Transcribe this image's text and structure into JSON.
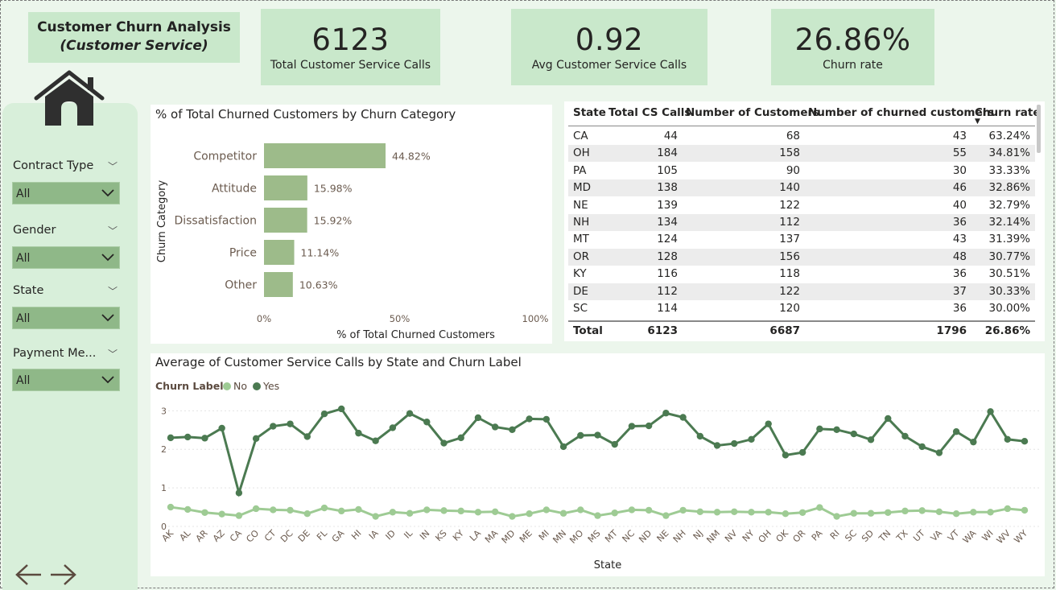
{
  "header": {
    "title_line1": "Customer Churn Analysis",
    "title_line2": "(Customer Service)"
  },
  "kpis": [
    {
      "value": "6123",
      "label": "Total Customer Service Calls"
    },
    {
      "value": "0.92",
      "label": "Avg Customer Service Calls"
    },
    {
      "value": "26.86%",
      "label": "Churn rate"
    }
  ],
  "icons": {
    "home": "home-icon",
    "back": "arrow-left-icon",
    "forward": "arrow-right-icon"
  },
  "slicers": [
    {
      "label": "Contract Type",
      "value": "All"
    },
    {
      "label": "Gender",
      "value": "All"
    },
    {
      "label": "State",
      "value": "All"
    },
    {
      "label": "Payment Me...",
      "value": "All"
    }
  ],
  "colors": {
    "accent": "#9dbb8a",
    "no": "#9ecb94",
    "yes": "#4b7a51"
  },
  "bar_chart": {
    "title": "% of Total Churned Customers by Churn Category",
    "chart_data": {
      "type": "bar",
      "categories": [
        "Competitor",
        "Attitude",
        "Dissatisfaction",
        "Price",
        "Other"
      ],
      "values": [
        44.82,
        15.98,
        15.92,
        11.14,
        10.63
      ],
      "value_labels": [
        "44.82%",
        "15.98%",
        "15.92%",
        "11.14%",
        "10.63%"
      ],
      "ylabel": "Churn Category",
      "xlabel": "% of Total Churned Customers",
      "xlim": [
        0,
        100
      ],
      "ticks": [
        "0%",
        "50%",
        "100%"
      ],
      "orientation": "horizontal"
    }
  },
  "table": {
    "headers": [
      "State",
      "Total CS Calls",
      "Number of Customers",
      "Number of churned customers",
      "Churn rate"
    ],
    "rows": [
      [
        "CA",
        "44",
        "68",
        "43",
        "63.24%"
      ],
      [
        "OH",
        "184",
        "158",
        "55",
        "34.81%"
      ],
      [
        "PA",
        "105",
        "90",
        "30",
        "33.33%"
      ],
      [
        "MD",
        "138",
        "140",
        "46",
        "32.86%"
      ],
      [
        "NE",
        "139",
        "122",
        "40",
        "32.79%"
      ],
      [
        "NH",
        "134",
        "112",
        "36",
        "32.14%"
      ],
      [
        "MT",
        "124",
        "137",
        "43",
        "31.39%"
      ],
      [
        "OR",
        "128",
        "156",
        "48",
        "30.77%"
      ],
      [
        "KY",
        "116",
        "118",
        "36",
        "30.51%"
      ],
      [
        "DE",
        "112",
        "122",
        "37",
        "30.33%"
      ],
      [
        "SC",
        "114",
        "120",
        "36",
        "30.00%"
      ]
    ],
    "total": [
      "Total",
      "6123",
      "6687",
      "1796",
      "26.86%"
    ]
  },
  "line_chart": {
    "title": "Average of Customer Service Calls by State and Churn Label",
    "legend_title": "Churn Label",
    "chart_data": {
      "type": "line",
      "categories": [
        "AK",
        "AL",
        "AR",
        "AZ",
        "CA",
        "CO",
        "CT",
        "DC",
        "DE",
        "FL",
        "GA",
        "HI",
        "IA",
        "ID",
        "IL",
        "IN",
        "KS",
        "KY",
        "LA",
        "MA",
        "MD",
        "ME",
        "MI",
        "MN",
        "MO",
        "MS",
        "MT",
        "NC",
        "ND",
        "NE",
        "NH",
        "NJ",
        "NM",
        "NV",
        "NY",
        "OH",
        "OK",
        "OR",
        "PA",
        "RI",
        "SC",
        "SD",
        "TN",
        "TX",
        "UT",
        "VA",
        "VT",
        "WA",
        "WI",
        "WV",
        "WY"
      ],
      "series": [
        {
          "name": "No",
          "values": [
            0.5,
            0.44,
            0.36,
            0.32,
            0.28,
            0.46,
            0.43,
            0.42,
            0.33,
            0.48,
            0.4,
            0.44,
            0.26,
            0.37,
            0.34,
            0.43,
            0.41,
            0.4,
            0.37,
            0.38,
            0.26,
            0.33,
            0.43,
            0.34,
            0.43,
            0.28,
            0.35,
            0.43,
            0.42,
            0.28,
            0.42,
            0.38,
            0.37,
            0.38,
            0.37,
            0.37,
            0.33,
            0.36,
            0.49,
            0.26,
            0.34,
            0.34,
            0.36,
            0.4,
            0.41,
            0.38,
            0.33,
            0.37,
            0.37,
            0.46,
            0.42
          ]
        },
        {
          "name": "Yes",
          "values": [
            2.3,
            2.32,
            2.29,
            2.55,
            0.87,
            2.28,
            2.6,
            2.66,
            2.33,
            2.92,
            3.05,
            2.42,
            2.22,
            2.56,
            2.93,
            2.71,
            2.16,
            2.3,
            2.82,
            2.58,
            2.51,
            2.79,
            2.78,
            2.07,
            2.36,
            2.37,
            2.13,
            2.6,
            2.61,
            2.94,
            2.83,
            2.34,
            2.1,
            2.15,
            2.26,
            2.66,
            1.85,
            1.92,
            2.53,
            2.51,
            2.4,
            2.25,
            2.8,
            2.34,
            2.07,
            1.91,
            2.46,
            2.19,
            2.98,
            2.26,
            2.21
          ]
        }
      ],
      "xlabel": "State",
      "ylabel": "",
      "ylim": [
        0,
        3.3
      ],
      "yticks": [
        "0",
        "1",
        "2",
        "3"
      ]
    }
  }
}
